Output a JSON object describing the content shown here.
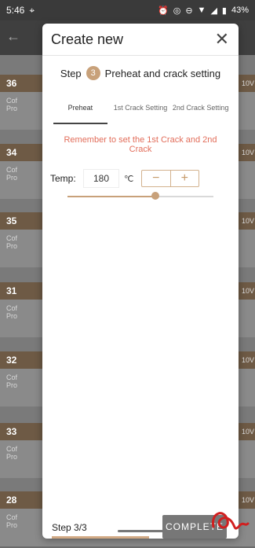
{
  "status": {
    "time": "5:46",
    "battery": "43%"
  },
  "background_cards": [
    {
      "num": "36",
      "line1": "Cof",
      "line2": "Pro",
      "right": "10V"
    },
    {
      "num": "34",
      "line1": "Cof",
      "line2": "Pro",
      "right": "10V"
    },
    {
      "num": "35",
      "line1": "Cof",
      "line2": "Pro",
      "right": "10V"
    },
    {
      "num": "31",
      "line1": "Cof",
      "line2": "Pro",
      "right": "10V"
    },
    {
      "num": "32",
      "line1": "Cof",
      "line2": "Pro",
      "right": "10V"
    },
    {
      "num": "33",
      "line1": "Cof",
      "line2": "Pro",
      "right": "10V"
    },
    {
      "num": "28",
      "line1": "Cof",
      "line2": "Pro",
      "right": "10V"
    }
  ],
  "dialog": {
    "title": "Create new",
    "step_word": "Step",
    "step_number": "3",
    "step_title": "Preheat and crack setting",
    "tabs": [
      {
        "label": "Preheat"
      },
      {
        "label": "1st Crack Setting"
      },
      {
        "label": "2nd Crack Setting"
      }
    ],
    "notice": "Remember to set the 1st Crack and 2nd Crack",
    "temp_label": "Temp:",
    "temp_value": "180",
    "temp_unit": "℃",
    "minus_label": "−",
    "plus_label": "+",
    "slider_fraction": 0.6,
    "footer_step": "Step 3/3",
    "complete_label": "COMPLETE"
  },
  "colors": {
    "accent": "#c8a17a",
    "notice": "#e26d5a",
    "card_header": "#6e5a45"
  }
}
